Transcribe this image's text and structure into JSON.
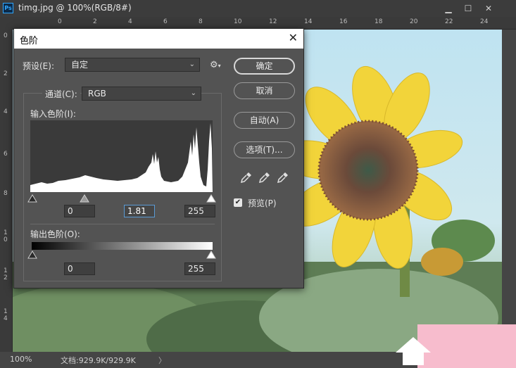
{
  "window": {
    "logo": "Ps",
    "title": "timg.jpg @ 100%(RGB/8#)",
    "minimize": "▁",
    "maximize": "☐",
    "close": "✕"
  },
  "ruler": {
    "top_ticks": [
      "0",
      "2",
      "4",
      "6",
      "8",
      "10",
      "12",
      "14",
      "16",
      "18",
      "20",
      "22",
      "24"
    ],
    "left_ticks": [
      "0",
      "2",
      "4",
      "6",
      "8",
      "1",
      "0",
      "1",
      "2",
      "1",
      "4"
    ]
  },
  "status": {
    "zoom": "100%",
    "doc_info": "文档:929.9K/929.9K",
    "arrow": "〉"
  },
  "dialog": {
    "title": "色阶",
    "close": "✕",
    "preset_label": "预设(E):",
    "preset_value": "自定",
    "channel_label": "通道(C):",
    "channel_value": "RGB",
    "input_levels_label": "输入色阶(I):",
    "output_levels_label": "输出色阶(O):",
    "input_black": "0",
    "input_gamma": "1.81",
    "input_white": "255",
    "output_black": "0",
    "output_white": "255",
    "buttons": {
      "ok": "确定",
      "cancel": "取消",
      "auto": "自动(A)",
      "options": "选项(T)..."
    },
    "preview_label": "预览(P)",
    "preview_checked": "✔"
  },
  "icons": {
    "gear": "⚙",
    "chevron": "⌄",
    "eyedropper": "✎"
  }
}
